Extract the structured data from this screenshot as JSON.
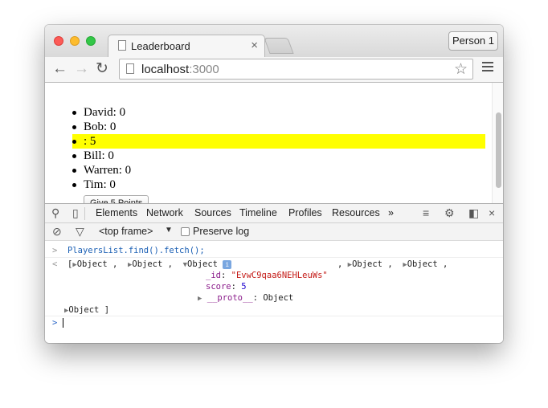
{
  "browser": {
    "tab_title": "Leaderboard",
    "tab_close": "×",
    "profile_button": "Person 1",
    "url_host": "localhost",
    "url_port": ":3000"
  },
  "page": {
    "players": [
      {
        "label": "David: 0",
        "selected": false
      },
      {
        "label": "Bob: 0",
        "selected": false
      },
      {
        "label": ": 5",
        "selected": true
      },
      {
        "label": "Bill: 0",
        "selected": false
      },
      {
        "label": "Warren: 0",
        "selected": false
      },
      {
        "label": "Tim: 0",
        "selected": false
      }
    ],
    "give_button": "Give 5 Points",
    "selected_color": "#ffff00"
  },
  "devtools": {
    "tabs": [
      "Elements",
      "Network",
      "Sources",
      "Timeline",
      "Profiles",
      "Resources"
    ],
    "more": "»",
    "frame_select": "<top frame>",
    "preserve_log_label": "Preserve log",
    "preserve_log_checked": false,
    "console": {
      "command": "PlayersList.find().fetch();",
      "result_open": "[",
      "object_label": "Object",
      "id_key": "_id",
      "id_value": "\"EvwC9qaa6NEHLeuWs\"",
      "score_key": "score",
      "score_value": "5",
      "proto_key": "__proto__",
      "proto_value": "Object",
      "result_close": "]"
    }
  }
}
